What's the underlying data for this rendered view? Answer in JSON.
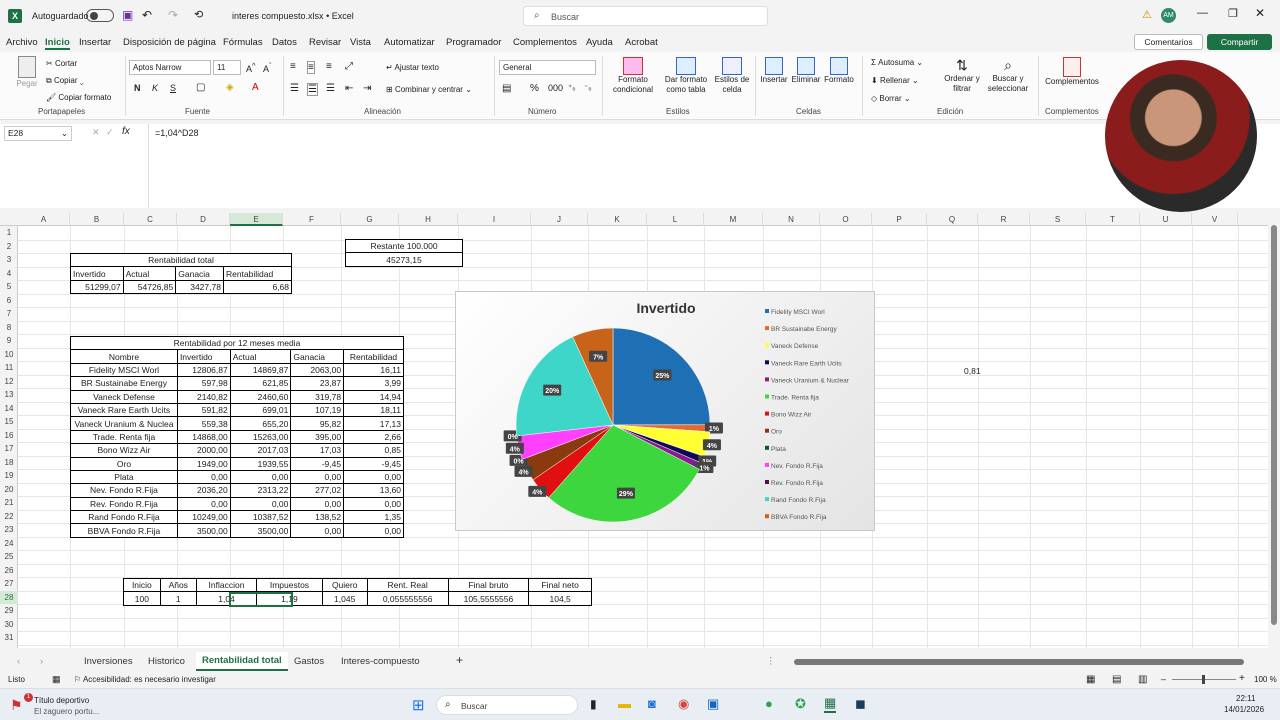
{
  "window": {
    "autosave_label": "Autoguardado",
    "filename": "interes compuesto.xlsx",
    "app_suffix": "• Excel",
    "search_placeholder": "Buscar",
    "user_initials": "AM"
  },
  "menu": {
    "tabs": [
      "Archivo",
      "Inicio",
      "Insertar",
      "Disposición de página",
      "Fórmulas",
      "Datos",
      "Revisar",
      "Vista",
      "Automatizar",
      "Programador",
      "Complementos",
      "Ayuda",
      "Acrobat"
    ],
    "comments": "Comentarios",
    "share": "Compartir"
  },
  "ribbon": {
    "clipboard": {
      "paste": "Pegar",
      "cut": "Cortar",
      "copy": "Copiar",
      "format_painter": "Copiar formato",
      "group": "Portapapeles"
    },
    "font": {
      "name": "Aptos Narrow",
      "size": "11",
      "bold": "N",
      "italic": "K",
      "underline": "S",
      "group": "Fuente"
    },
    "alignment": {
      "wrap": "Ajustar texto",
      "merge": "Combinar y centrar",
      "group": "Alineación"
    },
    "number": {
      "format": "General",
      "group": "Número"
    },
    "styles": {
      "conditional": "Formato condicional",
      "as_table": "Dar formato como tabla",
      "cell_styles": "Estilos de celda",
      "group": "Estilos"
    },
    "cells": {
      "insert": "Insertar",
      "delete": "Eliminar",
      "format": "Formato",
      "group": "Celdas"
    },
    "editing": {
      "autosum": "Autosuma",
      "fill": "Rellenar",
      "clear": "Borrar",
      "sort": "Ordenar y filtrar",
      "find": "Buscar y seleccionar",
      "group": "Edición"
    },
    "addins": {
      "label": "Complementos",
      "group": "Complementos"
    }
  },
  "formula_bar": {
    "cell_ref": "E28",
    "fx": "fx",
    "formula": "=1,04^D28"
  },
  "columns": [
    "A",
    "B",
    "C",
    "D",
    "E",
    "F",
    "G",
    "H",
    "I",
    "J",
    "K",
    "L",
    "M",
    "N",
    "O",
    "P",
    "Q",
    "R",
    "S",
    "T",
    "U",
    "V"
  ],
  "rows": [
    "1",
    "2",
    "3",
    "4",
    "5",
    "6",
    "7",
    "8",
    "9",
    "10",
    "11",
    "12",
    "13",
    "14",
    "15",
    "16",
    "17",
    "18",
    "19",
    "20",
    "21",
    "22",
    "23",
    "24",
    "25",
    "26",
    "27",
    "28",
    "29",
    "30",
    "31"
  ],
  "rentabilidad_total": {
    "title": "Rentabilidad total",
    "headers": [
      "Invertido",
      "Actual",
      "Ganacia",
      "Rentabilidad"
    ],
    "values": [
      "51299,07",
      "54726,85",
      "3427,78",
      "6,68"
    ]
  },
  "restante": {
    "label": "Restante 100.000",
    "value": "45273,15"
  },
  "cell_q11": "0,81",
  "mensual": {
    "title": "Rentabilidad por 12 meses media",
    "headers": [
      "Nombre",
      "Invertido",
      "Actual",
      "Ganacia",
      "Rentabilidad"
    ],
    "rows": [
      [
        "Fidelity MSCI Worl",
        "12806,87",
        "14869,87",
        "2063,00",
        "16,11"
      ],
      [
        "BR Sustainabe  Energy",
        "597,98",
        "621,85",
        "23,87",
        "3,99"
      ],
      [
        "Vaneck Defense",
        "2140,82",
        "2460,60",
        "319,78",
        "14,94"
      ],
      [
        "Vaneck Rare Earth Ucits",
        "591,82",
        "699,01",
        "107,19",
        "18,11"
      ],
      [
        "Vaneck Uranium & Nuclea",
        "559,38",
        "655,20",
        "95,82",
        "17,13"
      ],
      [
        "Trade. Renta fija",
        "14868,00",
        "15263,00",
        "395,00",
        "2,66"
      ],
      [
        "Bono Wizz Air",
        "2000,00",
        "2017,03",
        "17,03",
        "0,85"
      ],
      [
        "Oro",
        "1949,00",
        "1939,55",
        "-9,45",
        "-9,45"
      ],
      [
        "Plata",
        "0,00",
        "0,00",
        "0,00",
        "0,00"
      ],
      [
        "Nev. Fondo R.Fija",
        "2036,20",
        "2313,22",
        "277,02",
        "13,60"
      ],
      [
        "Rev. Fondo R.Fija",
        "0,00",
        "0,00",
        "0,00",
        "0,00"
      ],
      [
        "Rand Fondo R.Fija",
        "10249,00",
        "10387,52",
        "138,52",
        "1,35"
      ],
      [
        "BBVA Fondo R.Fija",
        "3500,00",
        "3500,00",
        "0,00",
        "0,00"
      ]
    ]
  },
  "interes": {
    "headers": [
      "Inicio",
      "Años",
      "Inflaccion",
      "Impuestos",
      "Quiero",
      "Rent. Real",
      "Final bruto",
      "Final neto"
    ],
    "values": [
      "100",
      "1",
      "1,04",
      "1,19",
      "1,045",
      "0,055555556",
      "105,5555556",
      "104,5"
    ]
  },
  "chart_data": {
    "type": "pie",
    "title": "Invertido",
    "labels": [
      "Fidelity MSCI Worl",
      "BR Sustainabe  Energy",
      "Vaneck Defense",
      "Vaneck Rare Earth Ucits",
      "Vaneck Uranium & Nuclear",
      "Trade. Renta fija",
      "Bono Wizz Air",
      "Oro",
      "Plata",
      "Nev. Fondo R.Fija",
      "Rev. Fondo R.Fija",
      "Rand Fondo R.Fija",
      "BBVA Fondo R.Fija"
    ],
    "values": [
      12806.87,
      597.98,
      2140.82,
      591.82,
      559.38,
      14868.0,
      2000.0,
      1949.0,
      0.0,
      2036.2,
      0.0,
      10249.0,
      3500.0
    ],
    "data_labels": [
      "25%",
      "1%",
      "4%",
      "1%",
      "1%",
      "29%",
      "4%",
      "4%",
      "0%",
      "4%",
      "0%",
      "20%",
      "7%"
    ],
    "colors": [
      "#1f6fb5",
      "#e86a2b",
      "#ffff33",
      "#0a0a5a",
      "#8b1a8b",
      "#3ed63e",
      "#e01010",
      "#8b3a0e",
      "#0b5a2a",
      "#ff40ff",
      "#5a0a5a",
      "#3ed6c8",
      "#c8641a"
    ],
    "legend_position": "right"
  },
  "sheets": [
    "Inversiones",
    "Historico",
    "Rentabilidad total",
    "Gastos",
    "Interes-compuesto"
  ],
  "active_sheet": "Rentabilidad total",
  "status": {
    "ready": "Listo",
    "accessibility": "Accesibilidad: es necesario investigar",
    "zoom": "100 %"
  },
  "taskbar": {
    "news_title": "Título deportivo",
    "news_sub": "El zaguero portu...",
    "badge": "1",
    "search": "Buscar",
    "time": "22:11",
    "date": "14/01/2026"
  }
}
